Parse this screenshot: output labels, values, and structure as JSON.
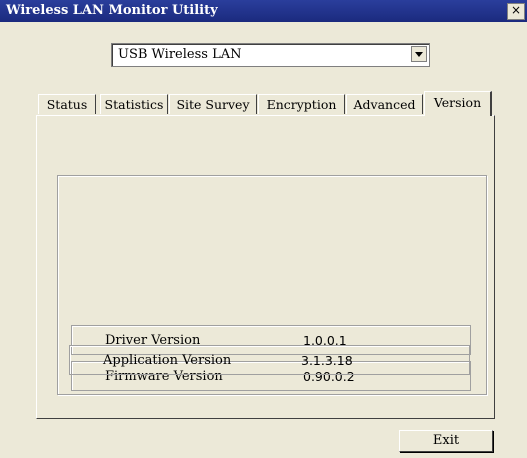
{
  "window": {
    "title": "Wireless LAN Monitor Utility",
    "close_glyph": "×"
  },
  "adapter_select": {
    "value": "USB Wireless LAN"
  },
  "tabs": [
    {
      "label": "Status"
    },
    {
      "label": "Statistics"
    },
    {
      "label": "Site Survey"
    },
    {
      "label": "Encryption"
    },
    {
      "label": "Advanced"
    },
    {
      "label": "Version"
    }
  ],
  "active_tab": "Version",
  "version_info": [
    {
      "label": "Driver Version",
      "value": "1.0.0.1"
    },
    {
      "label": "Firmware Version",
      "value": "0.90.0.2"
    },
    {
      "label": "Application Version",
      "value": "3.1.3.18"
    }
  ],
  "buttons": {
    "exit": "Exit"
  }
}
